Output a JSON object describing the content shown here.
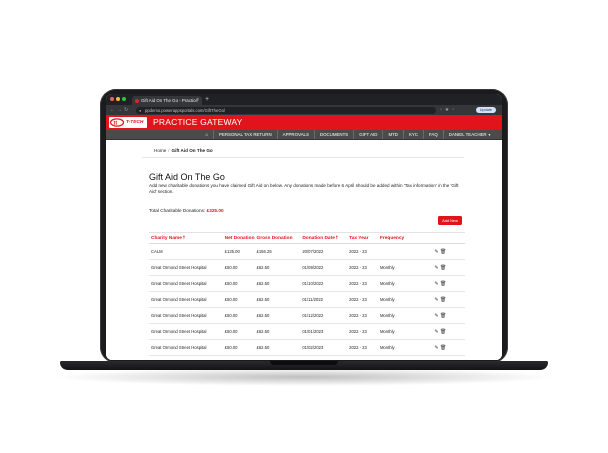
{
  "browser": {
    "tab_title": "Gift Aid On The Go - Practice",
    "url": "ppdemo.powerappsportals.com/GiftTheGo/",
    "update_label": "Update"
  },
  "app": {
    "logo_text": "T-TECH",
    "title": "PRACTICE GATEWAY",
    "accent": "#e2141b"
  },
  "menu": {
    "home_icon": "home-icon",
    "items": [
      "PERSONAL TAX RETURN",
      "APPROVALS",
      "DOCUMENTS",
      "GIFT AID",
      "MTD",
      "KYC",
      "FAQ"
    ],
    "user": "DANIEL TEACHER"
  },
  "breadcrumb": {
    "home": "Home",
    "current": "Gift Aid On The Go"
  },
  "page": {
    "title": "Gift Aid On The Go",
    "description": "Add new charitable donations you have claimed Gift Aid on below. Any donations made before 6 April should be added within 'Tax information' in the 'Gift Aid' section.",
    "total_label": "Total Charitable Donations:",
    "total_value": "£325.00",
    "add_button": "Add New"
  },
  "table": {
    "columns": [
      "Charity Name",
      "Net Donation",
      "Gross Donation",
      "Donation Date",
      "Tax Year",
      "Frequency"
    ],
    "rows": [
      [
        "CALM",
        "£125.00",
        "£156.25",
        "20/07/2022",
        "2022 - 23",
        ""
      ],
      [
        "Great Ormond Street Hospital",
        "£50.00",
        "£62.50",
        "01/09/2022",
        "2022 - 23",
        "Monthly"
      ],
      [
        "Great Ormond Street Hospital",
        "£50.00",
        "£62.50",
        "01/10/2022",
        "2022 - 23",
        "Monthly"
      ],
      [
        "Great Ormond Street Hospital",
        "£50.00",
        "£62.50",
        "01/11/2022",
        "2022 - 23",
        "Monthly"
      ],
      [
        "Great Ormond Street Hospital",
        "£50.00",
        "£62.50",
        "01/12/2022",
        "2022 - 23",
        "Monthly"
      ],
      [
        "Great Ormond Street Hospital",
        "£50.00",
        "£62.50",
        "01/01/2023",
        "2022 - 23",
        "Monthly"
      ],
      [
        "Great Ormond Street Hospital",
        "£50.00",
        "£62.50",
        "01/02/2023",
        "2022 - 23",
        "Monthly"
      ]
    ],
    "row_actions": [
      "edit-icon",
      "delete-icon"
    ]
  }
}
